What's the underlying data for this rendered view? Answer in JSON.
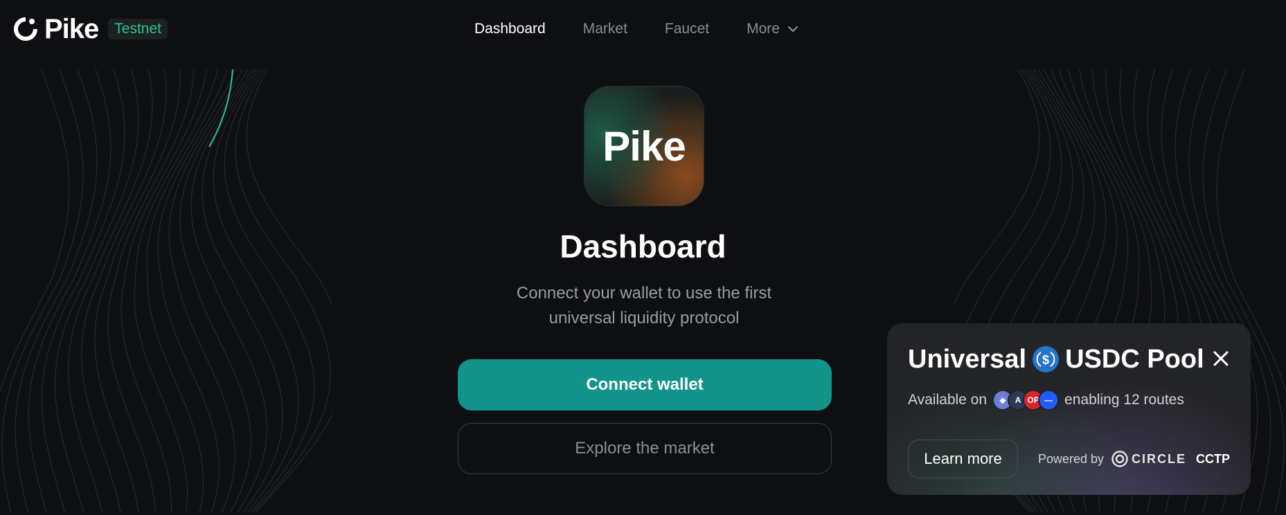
{
  "header": {
    "brand_name": "Pike",
    "badge": "Testnet",
    "nav": [
      {
        "label": "Dashboard",
        "active": true
      },
      {
        "label": "Market",
        "active": false
      },
      {
        "label": "Faucet",
        "active": false
      },
      {
        "label": "More",
        "active": false,
        "icon": "chevron-down-icon"
      }
    ]
  },
  "main": {
    "app_icon_text": "Pike",
    "title": "Dashboard",
    "subtitle_line1": "Connect your wallet to use the first",
    "subtitle_line2": "universal liquidity protocol",
    "connect_label": "Connect wallet",
    "explore_label": "Explore the market"
  },
  "promo": {
    "title_left": "Universal",
    "title_right": "USDC Pool",
    "available_label": "Available on",
    "routes_label": "enabling 12 routes",
    "chains": [
      {
        "icon": "ethereum-icon",
        "color": "#6b7fd8",
        "glyph": "◆"
      },
      {
        "icon": "arbitrum-icon",
        "color": "#2d3a55",
        "glyph": "A"
      },
      {
        "icon": "optimism-icon",
        "color": "#e0232b",
        "glyph": "OP"
      },
      {
        "icon": "base-icon",
        "color": "#1f5bff",
        "glyph": "—"
      }
    ],
    "learn_more_label": "Learn more",
    "powered_label": "Powered by",
    "circle_label": "CIRCLE",
    "cctp_label": "CCTP"
  },
  "colors": {
    "background": "#0e0f12",
    "accent": "#12948a",
    "badge_text": "#2fbf9e",
    "card": "#232427"
  }
}
